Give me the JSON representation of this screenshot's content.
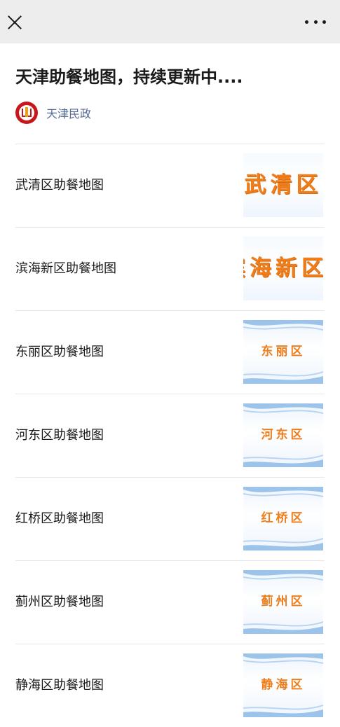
{
  "header": {
    "close_icon": "close-icon",
    "more_icon": "more-dots-icon"
  },
  "article": {
    "title": "天津助餐地图，持续更新中....",
    "account": {
      "name": "天津民政",
      "avatar_icon": "tianjin-civil-affairs-logo"
    }
  },
  "items": [
    {
      "label": "武清区助餐地图",
      "thumb_text": "武清区",
      "style": "big"
    },
    {
      "label": "滨海新区助餐地图",
      "thumb_text": "滨海新区",
      "style": "big"
    },
    {
      "label": "东丽区助餐地图",
      "thumb_text": "东丽区",
      "style": "wave"
    },
    {
      "label": "河东区助餐地图",
      "thumb_text": "河东区",
      "style": "wave"
    },
    {
      "label": "红桥区助餐地图",
      "thumb_text": "红桥区",
      "style": "wave"
    },
    {
      "label": "蓟州区助餐地图",
      "thumb_text": "蓟州区",
      "style": "wave"
    },
    {
      "label": "静海区助餐地图",
      "thumb_text": "静海区",
      "style": "wave"
    }
  ],
  "colors": {
    "accent_orange": "#ee7d1c",
    "account_blue": "#576b95",
    "logo_red": "#c8161d"
  }
}
